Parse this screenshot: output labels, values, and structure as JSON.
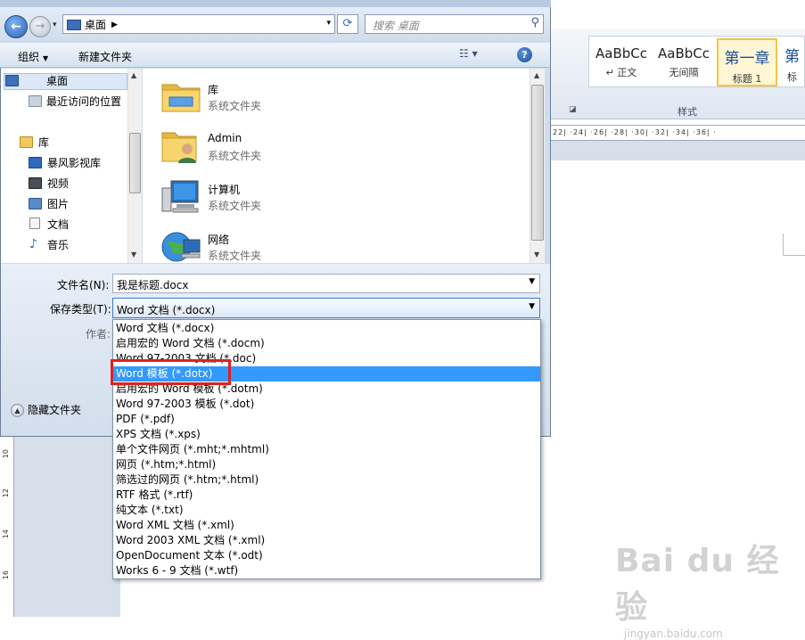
{
  "address": {
    "current_folder": "桌面",
    "search_placeholder": "搜索 桌面"
  },
  "toolbar": {
    "organize": "组织",
    "new_folder": "新建文件夹"
  },
  "nav_pane": {
    "selected": "桌面",
    "items": [
      {
        "label": "桌面",
        "icon": "desktop-icon"
      },
      {
        "label": "最近访问的位置",
        "icon": "recent-places-icon"
      },
      {
        "label": "库",
        "icon": "library-icon"
      },
      {
        "label": "暴风影视库",
        "icon": "video-library-icon"
      },
      {
        "label": "视频",
        "icon": "video-icon"
      },
      {
        "label": "图片",
        "icon": "picture-icon"
      },
      {
        "label": "文档",
        "icon": "document-icon"
      },
      {
        "label": "音乐",
        "icon": "music-icon"
      }
    ]
  },
  "files": [
    {
      "name": "库",
      "type": "系统文件夹",
      "icon": "library-folder-icon"
    },
    {
      "name": "Admin",
      "type": "系统文件夹",
      "icon": "user-folder-icon"
    },
    {
      "name": "计算机",
      "type": "系统文件夹",
      "icon": "computer-icon"
    },
    {
      "name": "网络",
      "type": "系统文件夹",
      "icon": "network-icon"
    }
  ],
  "form": {
    "filename_label": "文件名(N):",
    "filename_value": "我是标题.docx",
    "savetype_label": "保存类型(T):",
    "savetype_value": "Word 文档 (*.docx)",
    "author_label": "作者:",
    "hide_folders": "隐藏文件夹"
  },
  "save_types": {
    "selected_index": 3,
    "options": [
      "Word 文档 (*.docx)",
      "启用宏的 Word 文档 (*.docm)",
      "Word 97-2003 文档 (*.doc)",
      "Word 模板 (*.dotx)",
      "启用宏的 Word 模板 (*.dotm)",
      "Word 97-2003 模板 (*.dot)",
      "PDF (*.pdf)",
      "XPS 文档 (*.xps)",
      "单个文件网页 (*.mht;*.mhtml)",
      "网页 (*.htm;*.html)",
      "筛选过的网页 (*.htm;*.html)",
      "RTF 格式 (*.rtf)",
      "纯文本 (*.txt)",
      "Word XML 文档 (*.xml)",
      "Word 2003 XML 文档 (*.xml)",
      "OpenDocument 文本 (*.odt)",
      "Works 6 - 9 文档 (*.wtf)"
    ]
  },
  "ribbon": {
    "styles": [
      {
        "sample": "AaBbCc",
        "name": "↵ 正文"
      },
      {
        "sample": "AaBbCc",
        "name": "无间隔"
      },
      {
        "sample": "第一章",
        "name": "标题 1"
      },
      {
        "sample": "第",
        "name": "标"
      }
    ],
    "group_label": "样式",
    "ruler_text": "22| ·24| ·26| ·28| ·30| ·32| ·34| ·36| ·"
  },
  "left_ruler": [
    "10",
    "12",
    "14",
    "16"
  ],
  "watermark": {
    "brand": "Bai du 经验",
    "url": "jingyan.baidu.com"
  },
  "colors": {
    "selection": "#3399ff",
    "highlight_box": "#e0211e"
  }
}
